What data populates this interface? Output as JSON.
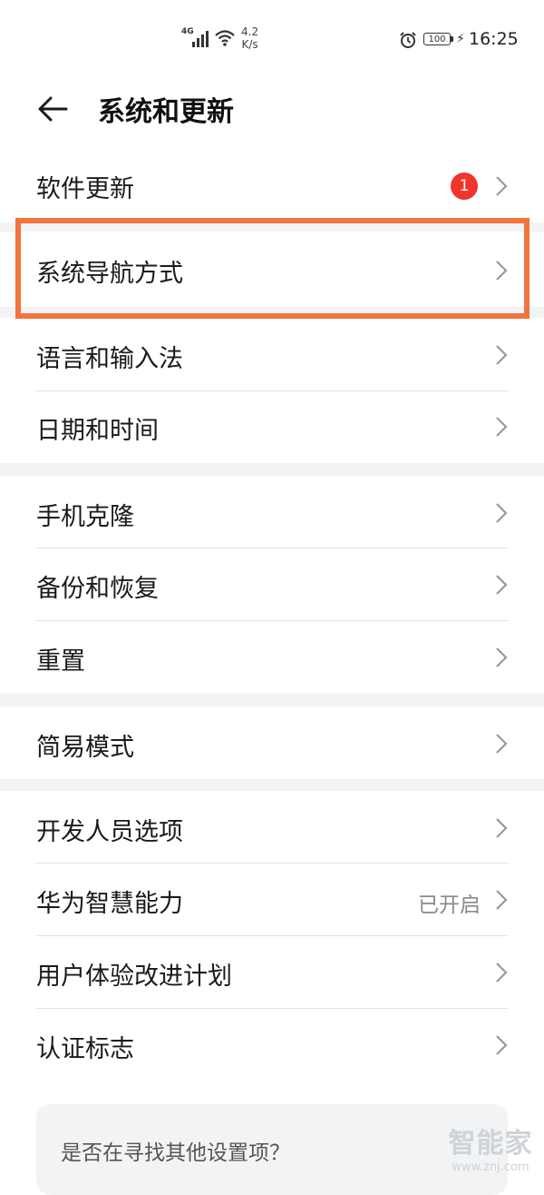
{
  "status_bar": {
    "network": "4G",
    "speed_value": "4.2",
    "speed_unit": "K/s",
    "battery": "100",
    "time": "16:25",
    "icons": [
      "signal-icon",
      "wifi-icon",
      "alarm-icon",
      "battery-icon",
      "charging-icon"
    ]
  },
  "header": {
    "back_icon": "arrow-left-icon",
    "title": "系统和更新"
  },
  "items": {
    "software_update": {
      "label": "软件更新",
      "badge": "1"
    },
    "system_navigation": {
      "label": "系统导航方式"
    },
    "language_input": {
      "label": "语言和输入法"
    },
    "date_time": {
      "label": "日期和时间"
    },
    "phone_clone": {
      "label": "手机克隆"
    },
    "backup_restore": {
      "label": "备份和恢复"
    },
    "reset": {
      "label": "重置"
    },
    "simple_mode": {
      "label": "简易模式"
    },
    "developer_options": {
      "label": "开发人员选项"
    },
    "huawei_ai": {
      "label": "华为智慧能力",
      "value": "已开启"
    },
    "user_experience": {
      "label": "用户体验改进计划"
    },
    "certification": {
      "label": "认证标志"
    }
  },
  "suggestion": {
    "text": "是否在寻找其他设置项？"
  },
  "watermark": {
    "logo": "智能家",
    "url": "www.znj.com"
  },
  "colors": {
    "highlight_border": "#f2743e",
    "badge": "#f0362c",
    "section_gap": "#f1f3f5"
  }
}
